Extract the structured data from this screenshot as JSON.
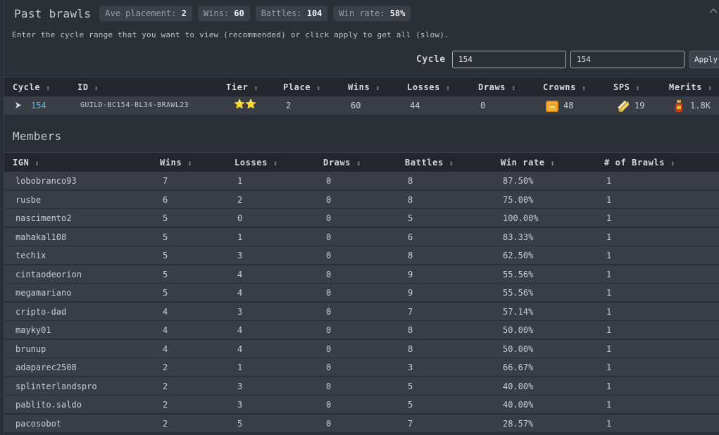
{
  "header": {
    "title": "Past brawls",
    "stats": [
      {
        "label": "Ave placement:",
        "value": "2"
      },
      {
        "label": "Wins:",
        "value": "60"
      },
      {
        "label": "Battles:",
        "value": "104"
      },
      {
        "label": "Win rate:",
        "value": "58%"
      }
    ]
  },
  "hint": "Enter the cycle range that you want to view (recommended) or click apply to get all (slow).",
  "cycle_range": {
    "label": "Cycle",
    "from_value": "154",
    "to_value": "154",
    "apply_label": "Apply"
  },
  "brawls_table": {
    "columns": [
      "Cycle",
      "ID",
      "Tier",
      "Place",
      "Wins",
      "Losses",
      "Draws",
      "Crowns",
      "SPS",
      "Merits"
    ],
    "rows": [
      {
        "cycle": "154",
        "id": "GUILD-BC154-BL34-BRAWL23",
        "tier": "⭐⭐",
        "place": "2",
        "wins": "60",
        "losses": "44",
        "draws": "0",
        "crowns": "48",
        "sps": "19",
        "merits": "1.8K"
      }
    ]
  },
  "members": {
    "title": "Members",
    "columns": [
      "IGN",
      "Wins",
      "Losses",
      "Draws",
      "Battles",
      "Win rate",
      "# of Brawls"
    ],
    "rows": [
      [
        "lobobranco93",
        "7",
        "1",
        "0",
        "8",
        "87.50%",
        "1"
      ],
      [
        "rusbe",
        "6",
        "2",
        "0",
        "8",
        "75.00%",
        "1"
      ],
      [
        "nascimento2",
        "5",
        "0",
        "0",
        "5",
        "100.00%",
        "1"
      ],
      [
        "mahakal108",
        "5",
        "1",
        "0",
        "6",
        "83.33%",
        "1"
      ],
      [
        "techix",
        "5",
        "3",
        "0",
        "8",
        "62.50%",
        "1"
      ],
      [
        "cintaodeorion",
        "5",
        "4",
        "0",
        "9",
        "55.56%",
        "1"
      ],
      [
        "megamariano",
        "5",
        "4",
        "0",
        "9",
        "55.56%",
        "1"
      ],
      [
        "cripto-dad",
        "4",
        "3",
        "0",
        "7",
        "57.14%",
        "1"
      ],
      [
        "mayky01",
        "4",
        "4",
        "0",
        "8",
        "50.00%",
        "1"
      ],
      [
        "brunup",
        "4",
        "4",
        "0",
        "8",
        "50.00%",
        "1"
      ],
      [
        "adaparec2508",
        "2",
        "1",
        "0",
        "3",
        "66.67%",
        "1"
      ],
      [
        "splinterlandspro",
        "2",
        "3",
        "0",
        "5",
        "40.00%",
        "1"
      ],
      [
        "pablito.saldo",
        "2",
        "3",
        "0",
        "5",
        "40.00%",
        "1"
      ],
      [
        "pacosobot",
        "2",
        "5",
        "0",
        "7",
        "28.57%",
        "1"
      ]
    ]
  },
  "icons": {
    "sort": "sort-icon",
    "collapse": "chevron-up-icon",
    "expand": "play-arrow-icon",
    "crowns": "crown-chest-icon",
    "sps": "sps-token-icon",
    "merits": "merits-potion-icon"
  },
  "colors": {
    "background": "#2b2f36",
    "table_header": "#23262c",
    "row": "#393d45",
    "link": "#5ab8e6",
    "star": "#f4c12b"
  }
}
